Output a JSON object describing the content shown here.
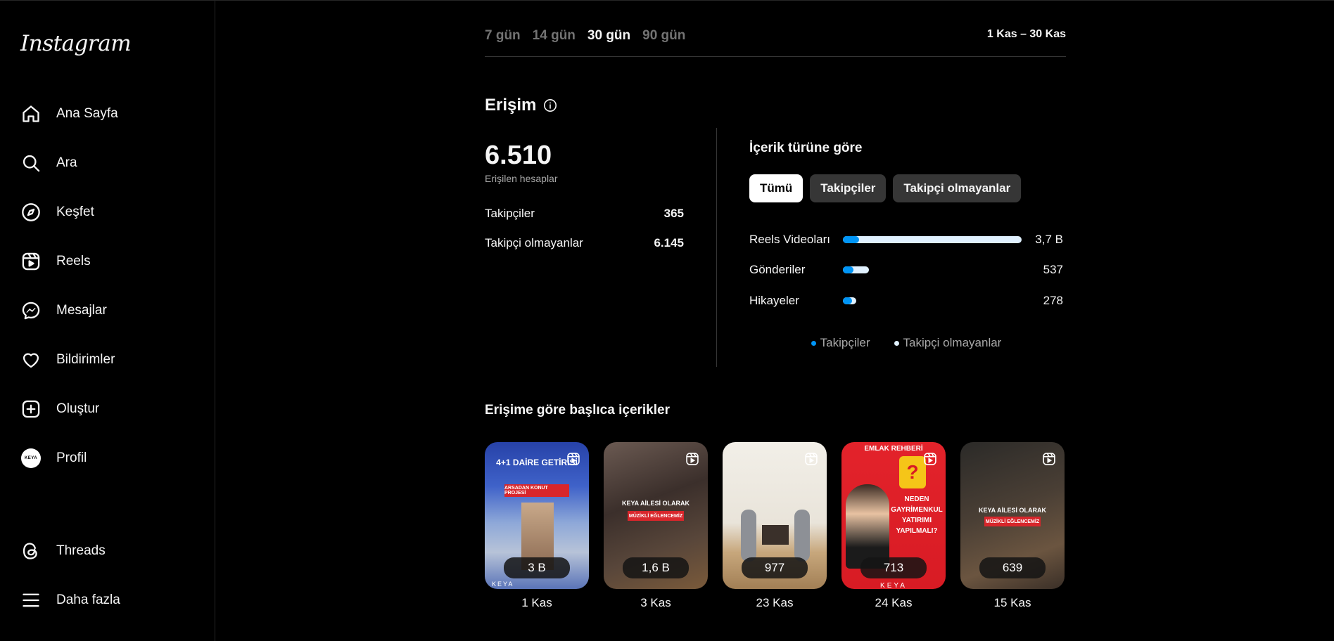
{
  "sidebar": {
    "logo": "Instagram",
    "items": [
      {
        "label": "Ana Sayfa",
        "icon": "home-icon"
      },
      {
        "label": "Ara",
        "icon": "search-icon"
      },
      {
        "label": "Keşfet",
        "icon": "explore-icon"
      },
      {
        "label": "Reels",
        "icon": "reels-icon"
      },
      {
        "label": "Mesajlar",
        "icon": "messenger-icon"
      },
      {
        "label": "Bildirimler",
        "icon": "heart-icon"
      },
      {
        "label": "Oluştur",
        "icon": "create-icon"
      },
      {
        "label": "Profil",
        "icon": "avatar"
      }
    ],
    "avatar_text": "KEYA",
    "bottom_items": [
      {
        "label": "Threads",
        "icon": "threads-icon"
      },
      {
        "label": "Daha fazla",
        "icon": "menu-icon"
      }
    ]
  },
  "range": {
    "tabs": [
      "7 gün",
      "14 gün",
      "30 gün",
      "90 gün"
    ],
    "active": "30 gün",
    "date_range": "1 Kas – 30 Kas"
  },
  "reach": {
    "title": "Erişim",
    "total": "6.510",
    "total_label": "Erişilen hesaplar",
    "rows": [
      {
        "label": "Takipçiler",
        "value": "365"
      },
      {
        "label": "Takipçi olmayanlar",
        "value": "6.145"
      }
    ]
  },
  "content_type": {
    "title": "İçerik türüne göre",
    "chips": [
      "Tümü",
      "Takipçiler",
      "Takipçi olmayanlar"
    ],
    "active_chip": "Tümü",
    "bars": [
      {
        "label": "Reels Videoları",
        "value": "3,7 B",
        "total_fraction": 1.0,
        "followers_fraction": 0.09
      },
      {
        "label": "Gönderiler",
        "value": "537",
        "total_fraction": 0.145,
        "followers_fraction": 0.06
      },
      {
        "label": "Hikayeler",
        "value": "278",
        "total_fraction": 0.075,
        "followers_fraction": 0.05
      }
    ],
    "legend": [
      {
        "label": "Takipçiler",
        "color": "#0095f6"
      },
      {
        "label": "Takipçi olmayanlar",
        "color": "#e0f1ff"
      }
    ]
  },
  "top_content": {
    "title": "Erişime göre başlıca içerikler",
    "items": [
      {
        "count": "3 B",
        "date": "1 Kas",
        "caption_top": "4+1 DAİRE GETİRİSİ",
        "caption_mid": "ARSADAN KONUT PROJESİ",
        "brand": "KEYA"
      },
      {
        "count": "1,6 B",
        "date": "3 Kas",
        "caption_top": "KEYA AİLESİ OLARAK",
        "caption_mid": "MÜZİKLİ EĞLENCEMİZ"
      },
      {
        "count": "977",
        "date": "23 Kas"
      },
      {
        "count": "713",
        "date": "24 Kas",
        "caption_top": "EMLAK REHBERİ",
        "caption_mid": "NEDEN GAYRİMENKUL YATIRIMI YAPILMALI?",
        "brand": "KEYA"
      },
      {
        "count": "639",
        "date": "15 Kas",
        "caption_top": "KEYA AİLESİ OLARAK",
        "caption_mid": "MÜZİKLİ EĞLENCEMİZ"
      }
    ]
  },
  "colors": {
    "background": "#000000",
    "accent": "#0095f6",
    "muted": "#737373"
  }
}
